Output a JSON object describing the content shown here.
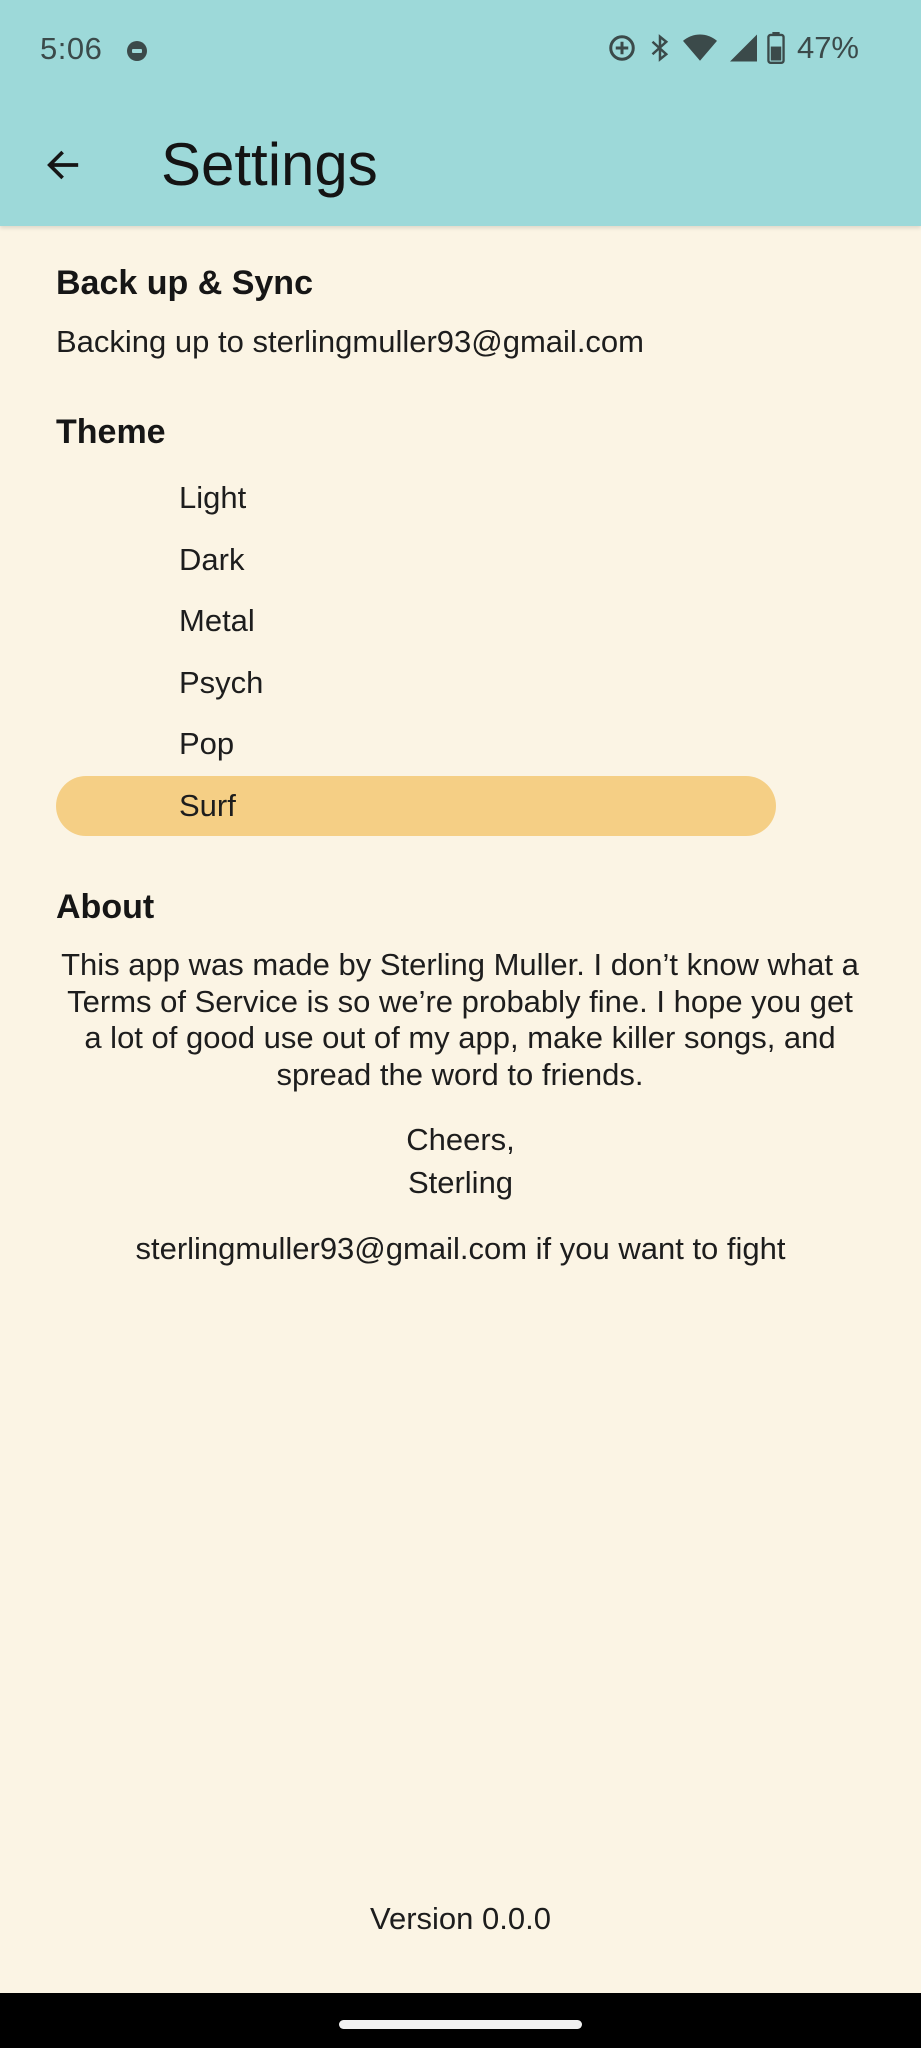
{
  "status_bar": {
    "time": "5:06",
    "battery_percent": "47%",
    "icons": [
      "do-not-disturb-icon",
      "data-saver-icon",
      "bluetooth-icon",
      "wifi-icon",
      "cell-signal-icon",
      "battery-icon"
    ]
  },
  "app_bar": {
    "title": "Settings",
    "back_icon": "arrow-left-icon",
    "background_color": "#9DD9D9"
  },
  "backup": {
    "heading": "Back up & Sync",
    "status": "Backing up to sterlingmuller93@gmail.com"
  },
  "theme": {
    "heading": "Theme",
    "options": [
      {
        "label": "Light"
      },
      {
        "label": "Dark"
      },
      {
        "label": "Metal"
      },
      {
        "label": "Psych"
      },
      {
        "label": "Pop"
      },
      {
        "label": "Surf"
      }
    ],
    "selected": "Surf",
    "selected_color": "#F5CF85"
  },
  "about": {
    "heading": "About",
    "lines": [
      "This app was made by Sterling Muller. I don’t know what a",
      "Terms of Service is so we’re probably fine. I hope you get",
      "a lot of good use out of my app, make killer songs, and",
      "spread the word to friends."
    ],
    "sign_off": "Cheers,",
    "signature": "Sterling",
    "contact": "sterlingmuller93@gmail.com if you want to fight"
  },
  "footer": {
    "version": "Version 0.0.0"
  },
  "colors": {
    "page_background": "#FBF4E4"
  }
}
